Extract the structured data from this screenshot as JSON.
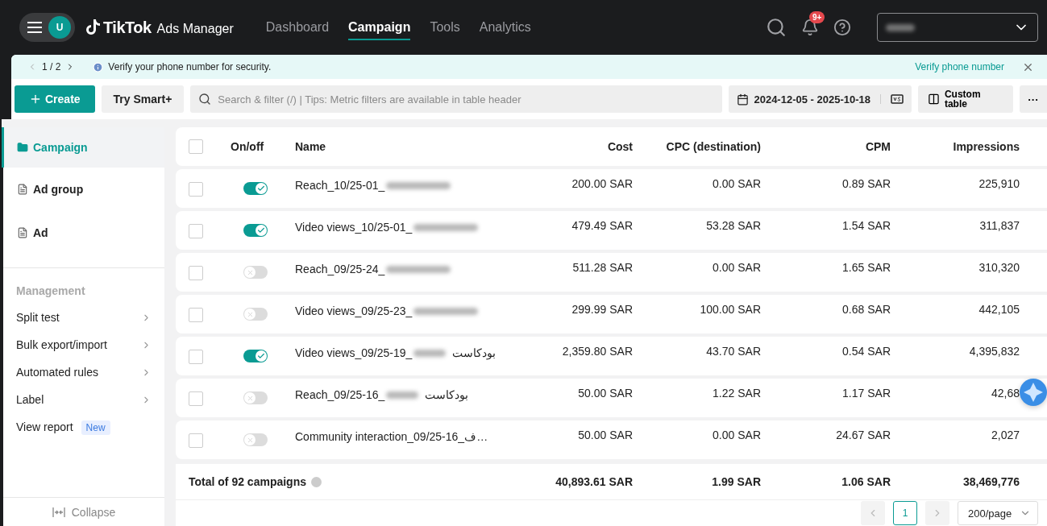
{
  "header": {
    "avatar": "U",
    "logo": "TikTok",
    "product": "Ads Manager",
    "nav": [
      {
        "label": "Dashboard",
        "selected": false
      },
      {
        "label": "Campaign",
        "selected": true
      },
      {
        "label": "Tools",
        "selected": false
      },
      {
        "label": "Analytics",
        "selected": false
      }
    ],
    "badge": "9+"
  },
  "banner": {
    "pager": "1 / 2",
    "message": "Verify your phone number for security.",
    "link": "Verify phone number"
  },
  "toolbar": {
    "create": "Create",
    "smart": "Try Smart+",
    "search_placeholder": "Search & filter (/) | Tips: Metric filters are available in table header",
    "date_range": "2024-12-05 - 2025-10-18",
    "custom_table": "Custom table",
    "more": "···"
  },
  "sidebar": {
    "levels": [
      {
        "label": "Campaign",
        "kind": "folder",
        "selected": true
      },
      {
        "label": "Ad group",
        "kind": "doc",
        "selected": false
      },
      {
        "label": "Ad",
        "kind": "doc",
        "selected": false
      }
    ],
    "management_title": "Management",
    "management": [
      {
        "label": "Split test",
        "kind": "menu"
      },
      {
        "label": "Bulk export/import",
        "kind": "menu"
      },
      {
        "label": "Automated rules",
        "kind": "menu"
      },
      {
        "label": "Label",
        "kind": "menu"
      },
      {
        "label": "View report",
        "kind": "badge",
        "badge": "New"
      }
    ],
    "collapse": "Collapse"
  },
  "table": {
    "select_all_checked": false,
    "columns": [
      "On/off",
      "Name",
      "Cost",
      "CPC (destination)",
      "CPM",
      "Impressions"
    ],
    "rows": [
      {
        "checked": false,
        "on": true,
        "name": "Reach_10/25-01_",
        "redacted": true,
        "cost": "200.00 SAR",
        "cpc": "0.00 SAR",
        "cpm": "0.89 SAR",
        "impressions": "225,910"
      },
      {
        "checked": false,
        "on": true,
        "name": "Video views_10/25-01_",
        "redacted": true,
        "cost": "479.49 SAR",
        "cpc": "53.28 SAR",
        "cpm": "1.54 SAR",
        "impressions": "311,837"
      },
      {
        "checked": false,
        "on": false,
        "name": "Reach_09/25-24_",
        "redacted": true,
        "cost": "511.28 SAR",
        "cpc": "0.00 SAR",
        "cpm": "1.65 SAR",
        "impressions": "310,320"
      },
      {
        "checked": false,
        "on": false,
        "name": "Video views_09/25-23_",
        "redacted": true,
        "cost": "299.99 SAR",
        "cpc": "100.00 SAR",
        "cpm": "0.68 SAR",
        "impressions": "442,105"
      },
      {
        "checked": false,
        "on": true,
        "name": "Video views_09/25-19_",
        "redacted": true,
        "name_tail": "بودكاست",
        "cost": "2,359.80 SAR",
        "cpc": "43.70 SAR",
        "cpm": "0.54 SAR",
        "impressions": "4,395,832"
      },
      {
        "checked": false,
        "on": false,
        "name": "Reach_09/25-16_",
        "redacted": true,
        "name_tail": "بودكاست",
        "cost": "50.00 SAR",
        "cpc": "1.22 SAR",
        "cpm": "1.17 SAR",
        "impressions": "42,68"
      },
      {
        "checked": false,
        "on": false,
        "name": "Community interaction_09/25-16_ف…",
        "redacted": false,
        "cost": "50.00 SAR",
        "cpc": "0.00 SAR",
        "cpm": "24.67 SAR",
        "impressions": "2,027"
      }
    ],
    "total": {
      "label": "Total of 92 campaigns",
      "cost": "40,893.61 SAR",
      "cpc": "1.99 SAR",
      "cpm": "1.06 SAR",
      "impressions": "38,469,776"
    }
  },
  "pagination": {
    "pages": [
      {
        "label": "1",
        "selected": true
      }
    ],
    "page_size": "200/page"
  }
}
